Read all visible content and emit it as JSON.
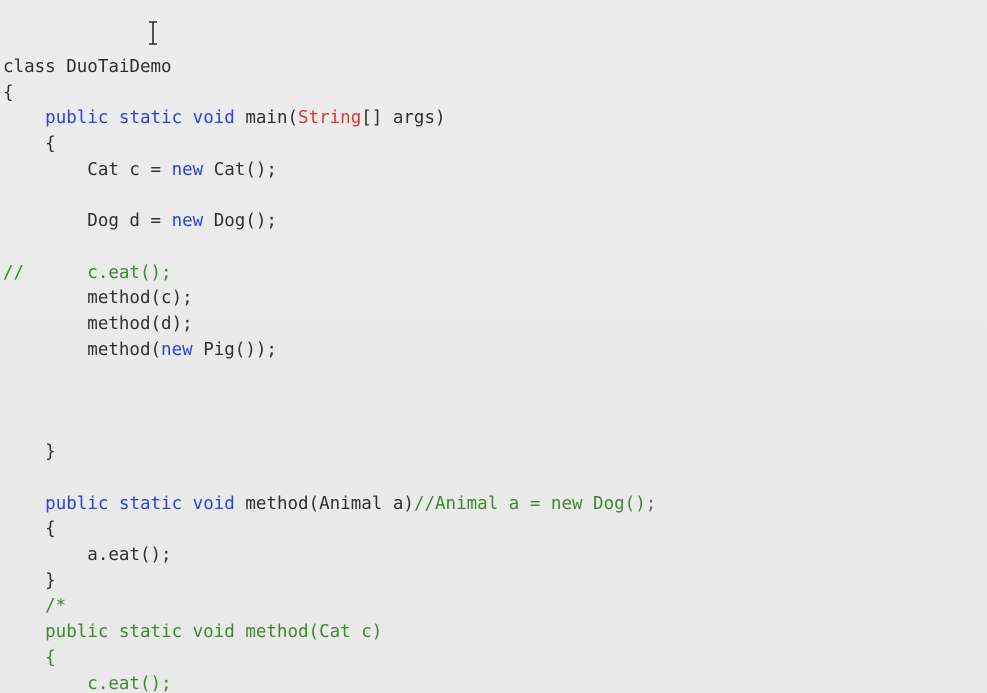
{
  "code": {
    "lines": [
      [
        {
          "t": "plain",
          "s": "class DuoTaiDemo"
        }
      ],
      [
        {
          "t": "plain",
          "s": "{"
        }
      ],
      [
        {
          "t": "plain",
          "s": "    "
        },
        {
          "t": "kw",
          "s": "public static void"
        },
        {
          "t": "plain",
          "s": " main("
        },
        {
          "t": "type-str",
          "s": "String"
        },
        {
          "t": "plain",
          "s": "[] args)"
        }
      ],
      [
        {
          "t": "plain",
          "s": "    {"
        }
      ],
      [
        {
          "t": "plain",
          "s": "        Cat c = "
        },
        {
          "t": "kw",
          "s": "new"
        },
        {
          "t": "plain",
          "s": " Cat();"
        }
      ],
      [],
      [
        {
          "t": "plain",
          "s": "        Dog d = "
        },
        {
          "t": "kw",
          "s": "new"
        },
        {
          "t": "plain",
          "s": " Dog();"
        }
      ],
      [],
      [
        {
          "t": "comment",
          "s": "//      c.eat();"
        }
      ],
      [
        {
          "t": "plain",
          "s": "        method(c);"
        }
      ],
      [
        {
          "t": "plain",
          "s": "        method(d);"
        }
      ],
      [
        {
          "t": "plain",
          "s": "        method("
        },
        {
          "t": "kw",
          "s": "new"
        },
        {
          "t": "plain",
          "s": " Pig());"
        }
      ],
      [],
      [],
      [],
      [
        {
          "t": "plain",
          "s": "    }"
        }
      ],
      [],
      [
        {
          "t": "plain",
          "s": "    "
        },
        {
          "t": "kw",
          "s": "public static void"
        },
        {
          "t": "plain",
          "s": " method(Animal a)"
        },
        {
          "t": "comment",
          "s": "//Animal a = new Dog();"
        }
      ],
      [
        {
          "t": "plain",
          "s": "    {"
        }
      ],
      [
        {
          "t": "plain",
          "s": "        a.eat();"
        }
      ],
      [
        {
          "t": "plain",
          "s": "    }"
        }
      ],
      [
        {
          "t": "comment",
          "s": "    /*"
        }
      ],
      [
        {
          "t": "comment",
          "s": "    public static void method(Cat c)"
        }
      ],
      [
        {
          "t": "comment",
          "s": "    {"
        }
      ],
      [
        {
          "t": "comment",
          "s": "        c.eat();"
        }
      ]
    ]
  },
  "colors": {
    "background": "#ebebeb",
    "keyword": "#2a43d8",
    "type_string": "#e0362c",
    "comment": "#3c8a2e",
    "text": "#303030"
  },
  "cursor": {
    "icon": "text-ibeam-cursor-icon"
  }
}
